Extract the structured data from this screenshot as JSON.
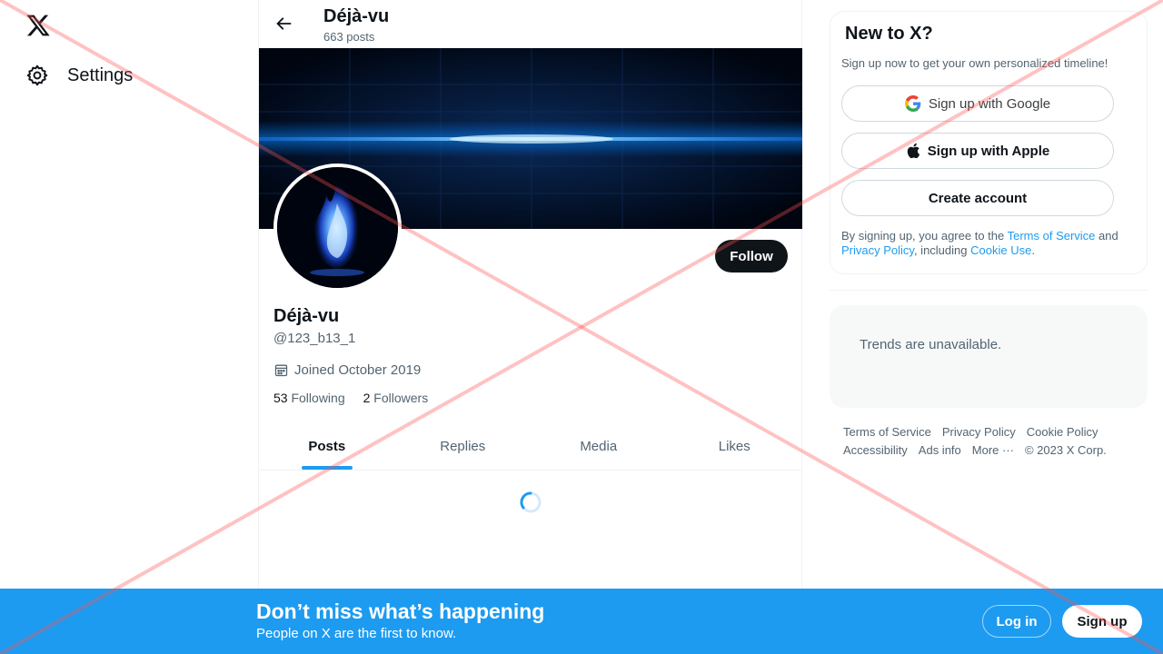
{
  "nav": {
    "settings_label": "Settings"
  },
  "header": {
    "name": "Déjà-vu",
    "post_count": "663 posts"
  },
  "profile": {
    "name": "Déjà-vu",
    "handle": "@123_b13_1",
    "joined": "Joined October 2019",
    "following_count": "53",
    "following_label": "Following",
    "followers_count": "2",
    "followers_label": "Followers",
    "follow_label": "Follow"
  },
  "tabs": [
    {
      "label": "Posts"
    },
    {
      "label": "Replies"
    },
    {
      "label": "Media"
    },
    {
      "label": "Likes"
    }
  ],
  "signup": {
    "title": "New to X?",
    "subtitle": "Sign up now to get your own personalized timeline!",
    "google_label": "Sign up with Google",
    "apple_label": "Sign up with Apple",
    "create_label": "Create account",
    "legal_prefix": "By signing up, you agree to the ",
    "terms_link": "Terms of Service",
    "legal_and": " and ",
    "privacy_link": "Privacy Policy",
    "legal_including": ", including ",
    "cookie_link": "Cookie Use",
    "legal_end": "."
  },
  "trends": {
    "text": "Trends are unavailable."
  },
  "footer": {
    "terms": "Terms of Service",
    "privacy": "Privacy Policy",
    "cookie": "Cookie Policy",
    "accessibility": "Accessibility",
    "ads": "Ads info",
    "more": "More ···",
    "copyright": "© 2023 X Corp."
  },
  "bottom_bar": {
    "headline": "Don’t miss what’s happening",
    "subtext": "People on X are the first to know.",
    "login_label": "Log in",
    "signup_label": "Sign up"
  },
  "colors": {
    "accent": "#1d9bf0",
    "text": "#0f1419",
    "muted": "#536471"
  }
}
